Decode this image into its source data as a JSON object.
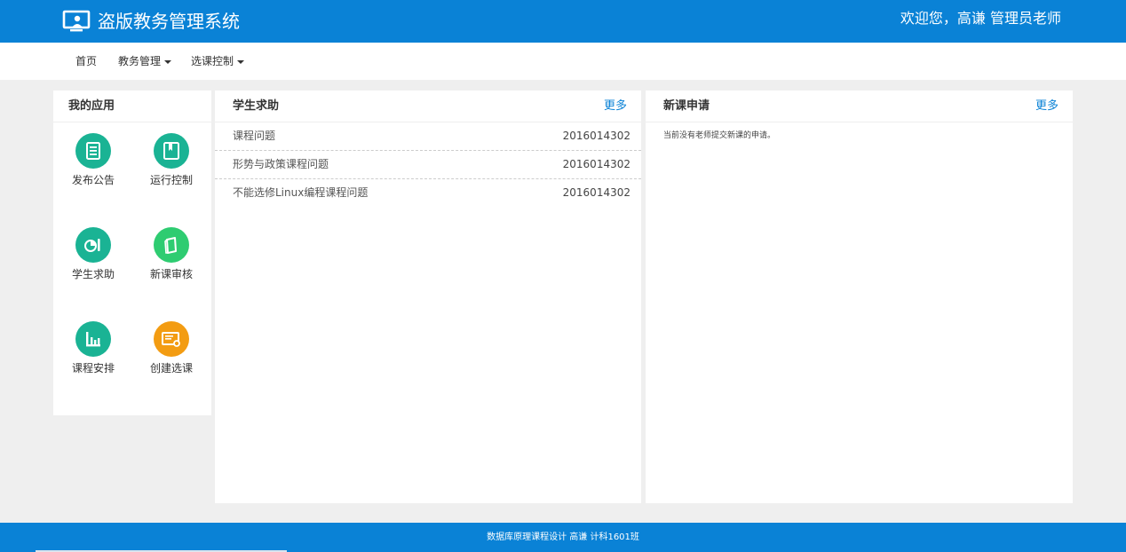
{
  "header": {
    "brand_icon": "monitor-user-icon",
    "title": "盗版教务管理系统",
    "welcome": "欢迎您，高谦 管理员老师"
  },
  "nav": {
    "home": "首页",
    "academic": "教务管理",
    "course_selection": "选课控制"
  },
  "apps": {
    "title": "我的应用",
    "items": [
      {
        "label": "发布公告",
        "icon": "notice-icon",
        "color": "#1ab394"
      },
      {
        "label": "运行控制",
        "icon": "book-icon",
        "color": "#1ab394"
      },
      {
        "label": "学生求助",
        "icon": "pie-pencil-icon",
        "color": "#1ab394"
      },
      {
        "label": "新课审核",
        "icon": "notebook-icon",
        "color": "#2ecc71"
      },
      {
        "label": "课程安排",
        "icon": "bar-chart-icon",
        "color": "#1ab394"
      },
      {
        "label": "创建选课",
        "icon": "certificate-icon",
        "color": "#f39c12"
      }
    ]
  },
  "help": {
    "title": "学生求助",
    "more": "更多",
    "rows": [
      {
        "question": "课程问题",
        "student_id": "2016014302"
      },
      {
        "question": "形势与政策课程问题",
        "student_id": "2016014302"
      },
      {
        "question": "不能选修Linux编程课程问题",
        "student_id": "2016014302"
      }
    ]
  },
  "newcourse": {
    "title": "新课申请",
    "more": "更多",
    "empty": "当前没有老师提交新课的申请。"
  },
  "footer": {
    "text": "数据库原理课程设计 高谦 计科1601班"
  },
  "colors": {
    "primary": "#0a82d6",
    "teal": "#1ab394",
    "green": "#2ecc71",
    "orange": "#f39c12"
  }
}
